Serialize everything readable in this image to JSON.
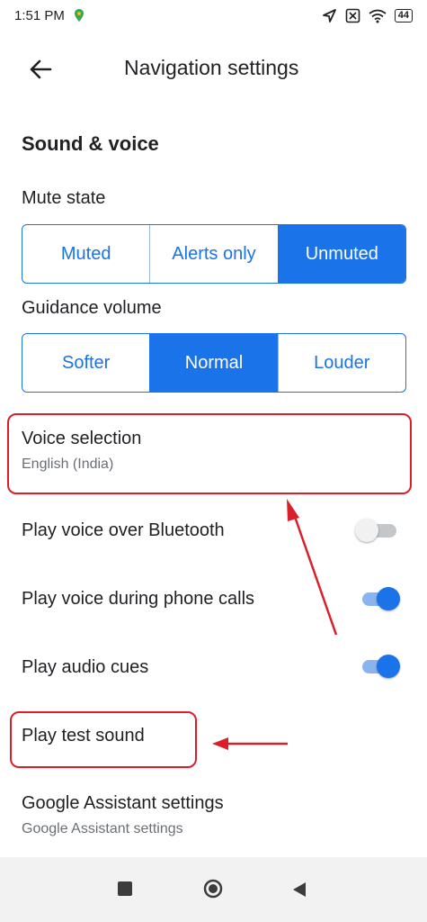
{
  "status_bar": {
    "time": "1:51 PM",
    "battery": "44",
    "icons": [
      "location-pin-icon",
      "navigation-arrow-icon",
      "sim-x-icon",
      "wifi-icon",
      "battery-icon"
    ]
  },
  "app_bar": {
    "title": "Navigation settings",
    "back_icon": "back-arrow-icon"
  },
  "section": {
    "title": "Sound & voice"
  },
  "mute_state": {
    "label": "Mute state",
    "options": [
      "Muted",
      "Alerts only",
      "Unmuted"
    ],
    "selected": "Unmuted"
  },
  "guidance_volume": {
    "label": "Guidance volume",
    "options": [
      "Softer",
      "Normal",
      "Louder"
    ],
    "selected": "Normal"
  },
  "voice_selection": {
    "title": "Voice selection",
    "subtitle": "English (India)"
  },
  "toggles": [
    {
      "label": "Play voice over Bluetooth",
      "on": false
    },
    {
      "label": "Play voice during phone calls",
      "on": true
    },
    {
      "label": "Play audio cues",
      "on": true
    }
  ],
  "play_test_sound": {
    "title": "Play test sound"
  },
  "assistant": {
    "title": "Google Assistant settings",
    "subtitle": "Google Assistant settings"
  },
  "colors": {
    "accent": "#1a73e8",
    "annotation": "#d9202a"
  },
  "nav_bar": {
    "icons": [
      "recents-square-icon",
      "home-circle-icon",
      "back-triangle-icon"
    ]
  }
}
